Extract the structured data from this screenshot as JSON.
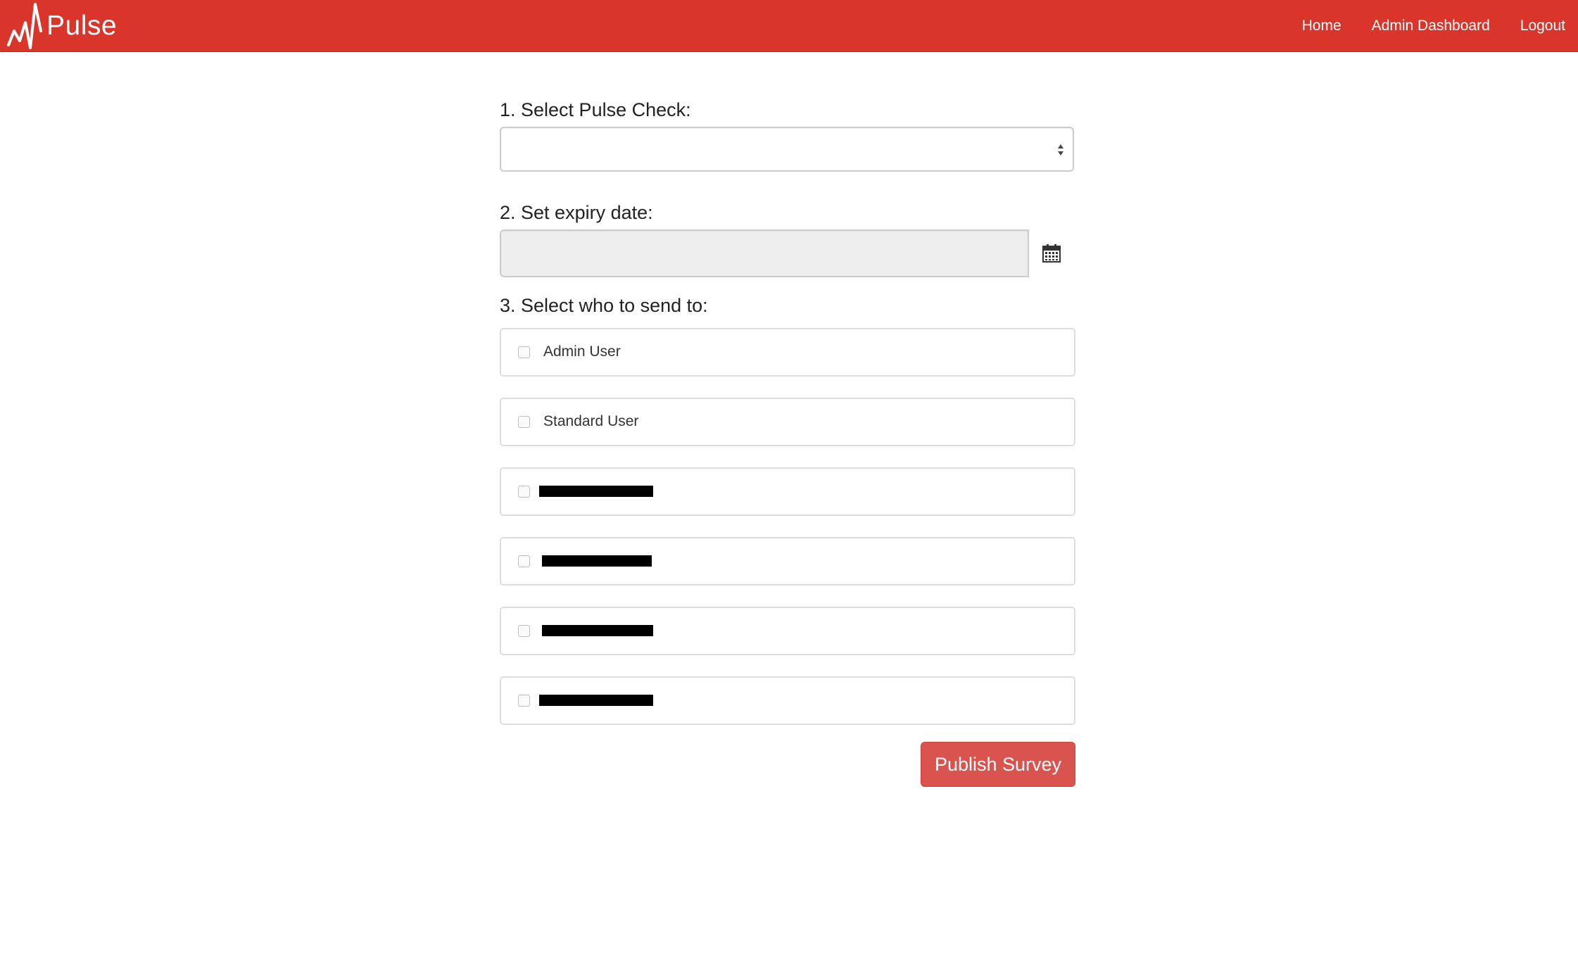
{
  "brand": {
    "name": "Pulse"
  },
  "nav": {
    "items": [
      {
        "label": "Home"
      },
      {
        "label": "Admin Dashboard"
      },
      {
        "label": "Logout"
      }
    ]
  },
  "form": {
    "step1_label": "1. Select Pulse Check:",
    "pulse_check_value": "",
    "step2_label": "2. Set expiry date:",
    "expiry_date_value": "",
    "step3_label": "3. Select who to send to:",
    "recipients": [
      {
        "label": "Admin User",
        "checked": false
      },
      {
        "label": "Standard User",
        "checked": false
      },
      {
        "label": "",
        "checked": false,
        "redacted": true
      },
      {
        "label": "",
        "checked": false,
        "redacted": true
      },
      {
        "label": "",
        "checked": false,
        "redacted": true
      },
      {
        "label": "",
        "checked": false,
        "redacted": true
      }
    ],
    "publish_label": "Publish Survey"
  },
  "colors": {
    "navbar": "#d9352a",
    "publish_button": "#d9534f"
  },
  "icons": [
    "pulse-logo-icon",
    "select-arrows-icon",
    "calendar-icon"
  ]
}
